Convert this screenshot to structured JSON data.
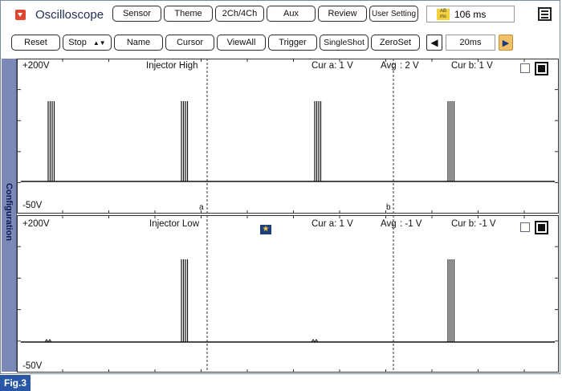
{
  "header": {
    "title": "Oscilloscope",
    "tabs": [
      "Sensor",
      "Theme",
      "2Ch/4Ch",
      "Aux",
      "Review",
      "User Setting"
    ],
    "time_readout": "106 ms"
  },
  "toolbar": {
    "reset": "Reset",
    "stop": "Stop",
    "name": "Name",
    "cursor": "Cursor",
    "viewall": "ViewAll",
    "trigger": "Trigger",
    "singleshot": "SingleShot",
    "zeroset": "ZeroSet",
    "timebase": "20ms"
  },
  "sidebar": {
    "label": "Configuration"
  },
  "channels": [
    {
      "name": "Injector High",
      "ymax": "+200V",
      "ymin": "-50V",
      "cur_a": "Cur a: 1 V",
      "avg_label": "Avg",
      "avg": ": 2 V",
      "cur_b": "Cur b: 1 V",
      "cursor_a": "a",
      "cursor_b": "b"
    },
    {
      "name": "Injector Low",
      "ymax": "+200V",
      "ymin": "-50V",
      "cur_a": "Cur a: 1 V",
      "avg_label": "Avg",
      "avg": ": -1 V",
      "cur_b": "Cur b: -1 V"
    }
  ],
  "figure_label": "Fig.3",
  "colors": {
    "accent": "#e0452f",
    "sidebar": "#7c88b6",
    "fig": "#2a56a6"
  }
}
